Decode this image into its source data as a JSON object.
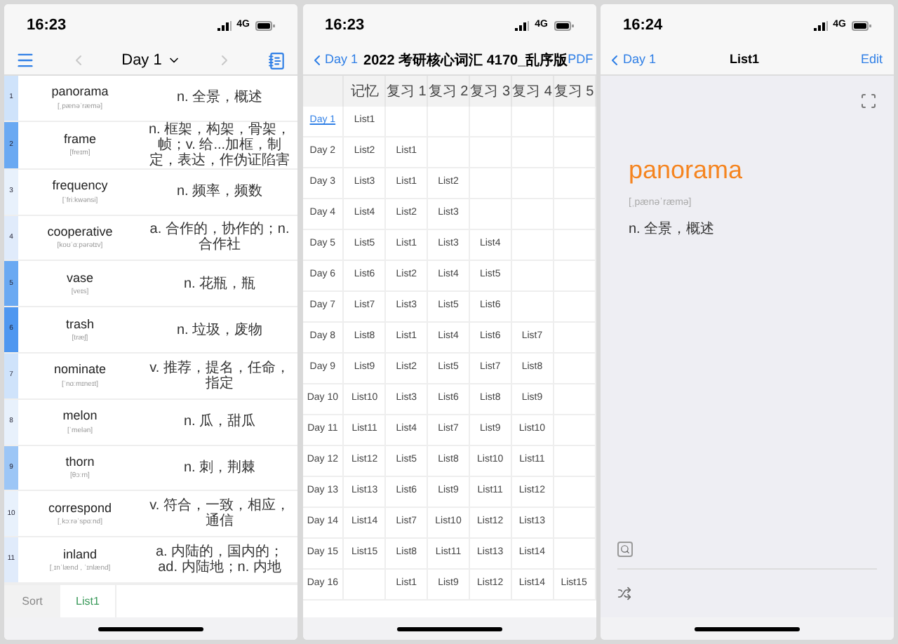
{
  "word_list": {
    "status": {
      "time": "16:23",
      "network": "4G"
    },
    "nav": {
      "title": "Day 1"
    },
    "rows": [
      {
        "index": "1",
        "word": "panorama",
        "phonetic": "[ˌpænəˈræmə]",
        "meaning": "n. 全景，概述",
        "color": "#cfe3fb"
      },
      {
        "index": "2",
        "word": "frame",
        "phonetic": "[freɪm]",
        "meaning": "n. 框架，构架，骨架，帧；v. 给...加框，制定，表达，作伪证陷害",
        "color": "#6aa9f2"
      },
      {
        "index": "3",
        "word": "frequency",
        "phonetic": "[ˈfriːkwənsi]",
        "meaning": "n. 频率，频数",
        "color": "#e8f1fc"
      },
      {
        "index": "4",
        "word": "cooperative",
        "phonetic": "[koʊˈɑːpərətɪv]",
        "meaning": "a. 合作的，协作的；n. 合作社",
        "color": "#e0ebfb"
      },
      {
        "index": "5",
        "word": "vase",
        "phonetic": "[veɪs]",
        "meaning": "n. 花瓶，瓶",
        "color": "#6aa9f2"
      },
      {
        "index": "6",
        "word": "trash",
        "phonetic": "[træʃ]",
        "meaning": "n. 垃圾，废物",
        "color": "#4f97f0"
      },
      {
        "index": "7",
        "word": "nominate",
        "phonetic": "[ˈnɑːmɪneɪt]",
        "meaning": "v. 推荐，提名，任命，指定",
        "color": "#cfe3fb"
      },
      {
        "index": "8",
        "word": "melon",
        "phonetic": "[ˈmelən]",
        "meaning": "n. 瓜，甜瓜",
        "color": "#e8f1fc"
      },
      {
        "index": "9",
        "word": "thorn",
        "phonetic": "[θɔːrn]",
        "meaning": "n. 刺，荆棘",
        "color": "#9cc6f6"
      },
      {
        "index": "10",
        "word": "correspond",
        "phonetic": "[ˌkɔːrəˈspɑːnd]",
        "meaning": "v. 符合，一致，相应，通信",
        "color": "#e8f1fc"
      },
      {
        "index": "11",
        "word": "inland",
        "phonetic": "[ˌɪnˈlænd , ˈɪnlænd]",
        "meaning": "a. 内陆的，国内的；ad. 内陆地；n. 内地",
        "color": "#e0ebfb"
      }
    ],
    "tabs": [
      {
        "label": "Sort",
        "selected": false
      },
      {
        "label": "List1",
        "selected": true
      }
    ]
  },
  "schedule": {
    "status": {
      "time": "16:23",
      "network": "4G"
    },
    "nav": {
      "back": "Day 1",
      "title": "2022 考研核心词汇 4170_乱序版",
      "action": "PDF"
    },
    "columns": [
      "记忆",
      "复习 1",
      "复习 2",
      "复习 3",
      "复习 4",
      "复习 5"
    ],
    "rows": [
      {
        "day": "Day 1",
        "selected": true,
        "cells": [
          "List1",
          "",
          "",
          "",
          "",
          ""
        ]
      },
      {
        "day": "Day 2",
        "selected": false,
        "cells": [
          "List2",
          "List1",
          "",
          "",
          "",
          ""
        ]
      },
      {
        "day": "Day 3",
        "selected": false,
        "cells": [
          "List3",
          "List1",
          "List2",
          "",
          "",
          ""
        ]
      },
      {
        "day": "Day 4",
        "selected": false,
        "cells": [
          "List4",
          "List2",
          "List3",
          "",
          "",
          ""
        ]
      },
      {
        "day": "Day 5",
        "selected": false,
        "cells": [
          "List5",
          "List1",
          "List3",
          "List4",
          "",
          ""
        ]
      },
      {
        "day": "Day 6",
        "selected": false,
        "cells": [
          "List6",
          "List2",
          "List4",
          "List5",
          "",
          ""
        ]
      },
      {
        "day": "Day 7",
        "selected": false,
        "cells": [
          "List7",
          "List3",
          "List5",
          "List6",
          "",
          ""
        ]
      },
      {
        "day": "Day 8",
        "selected": false,
        "cells": [
          "List8",
          "List1",
          "List4",
          "List6",
          "List7",
          ""
        ]
      },
      {
        "day": "Day 9",
        "selected": false,
        "cells": [
          "List9",
          "List2",
          "List5",
          "List7",
          "List8",
          ""
        ]
      },
      {
        "day": "Day 10",
        "selected": false,
        "cells": [
          "List10",
          "List3",
          "List6",
          "List8",
          "List9",
          ""
        ]
      },
      {
        "day": "Day 11",
        "selected": false,
        "cells": [
          "List11",
          "List4",
          "List7",
          "List9",
          "List10",
          ""
        ]
      },
      {
        "day": "Day 12",
        "selected": false,
        "cells": [
          "List12",
          "List5",
          "List8",
          "List10",
          "List11",
          ""
        ]
      },
      {
        "day": "Day 13",
        "selected": false,
        "cells": [
          "List13",
          "List6",
          "List9",
          "List11",
          "List12",
          ""
        ]
      },
      {
        "day": "Day 14",
        "selected": false,
        "cells": [
          "List14",
          "List7",
          "List10",
          "List12",
          "List13",
          ""
        ]
      },
      {
        "day": "Day 15",
        "selected": false,
        "cells": [
          "List15",
          "List8",
          "List11",
          "List13",
          "List14",
          ""
        ]
      },
      {
        "day": "Day 16",
        "selected": false,
        "cells": [
          "",
          "List1",
          "List9",
          "List12",
          "List14",
          "List15"
        ]
      }
    ]
  },
  "card": {
    "status": {
      "time": "16:24",
      "network": "4G"
    },
    "nav": {
      "back": "Day 1",
      "title": "List1",
      "action": "Edit"
    },
    "word": "panorama",
    "phonetic": "[ˌpænəˈræmə]",
    "meaning": "n. 全景，概述"
  }
}
